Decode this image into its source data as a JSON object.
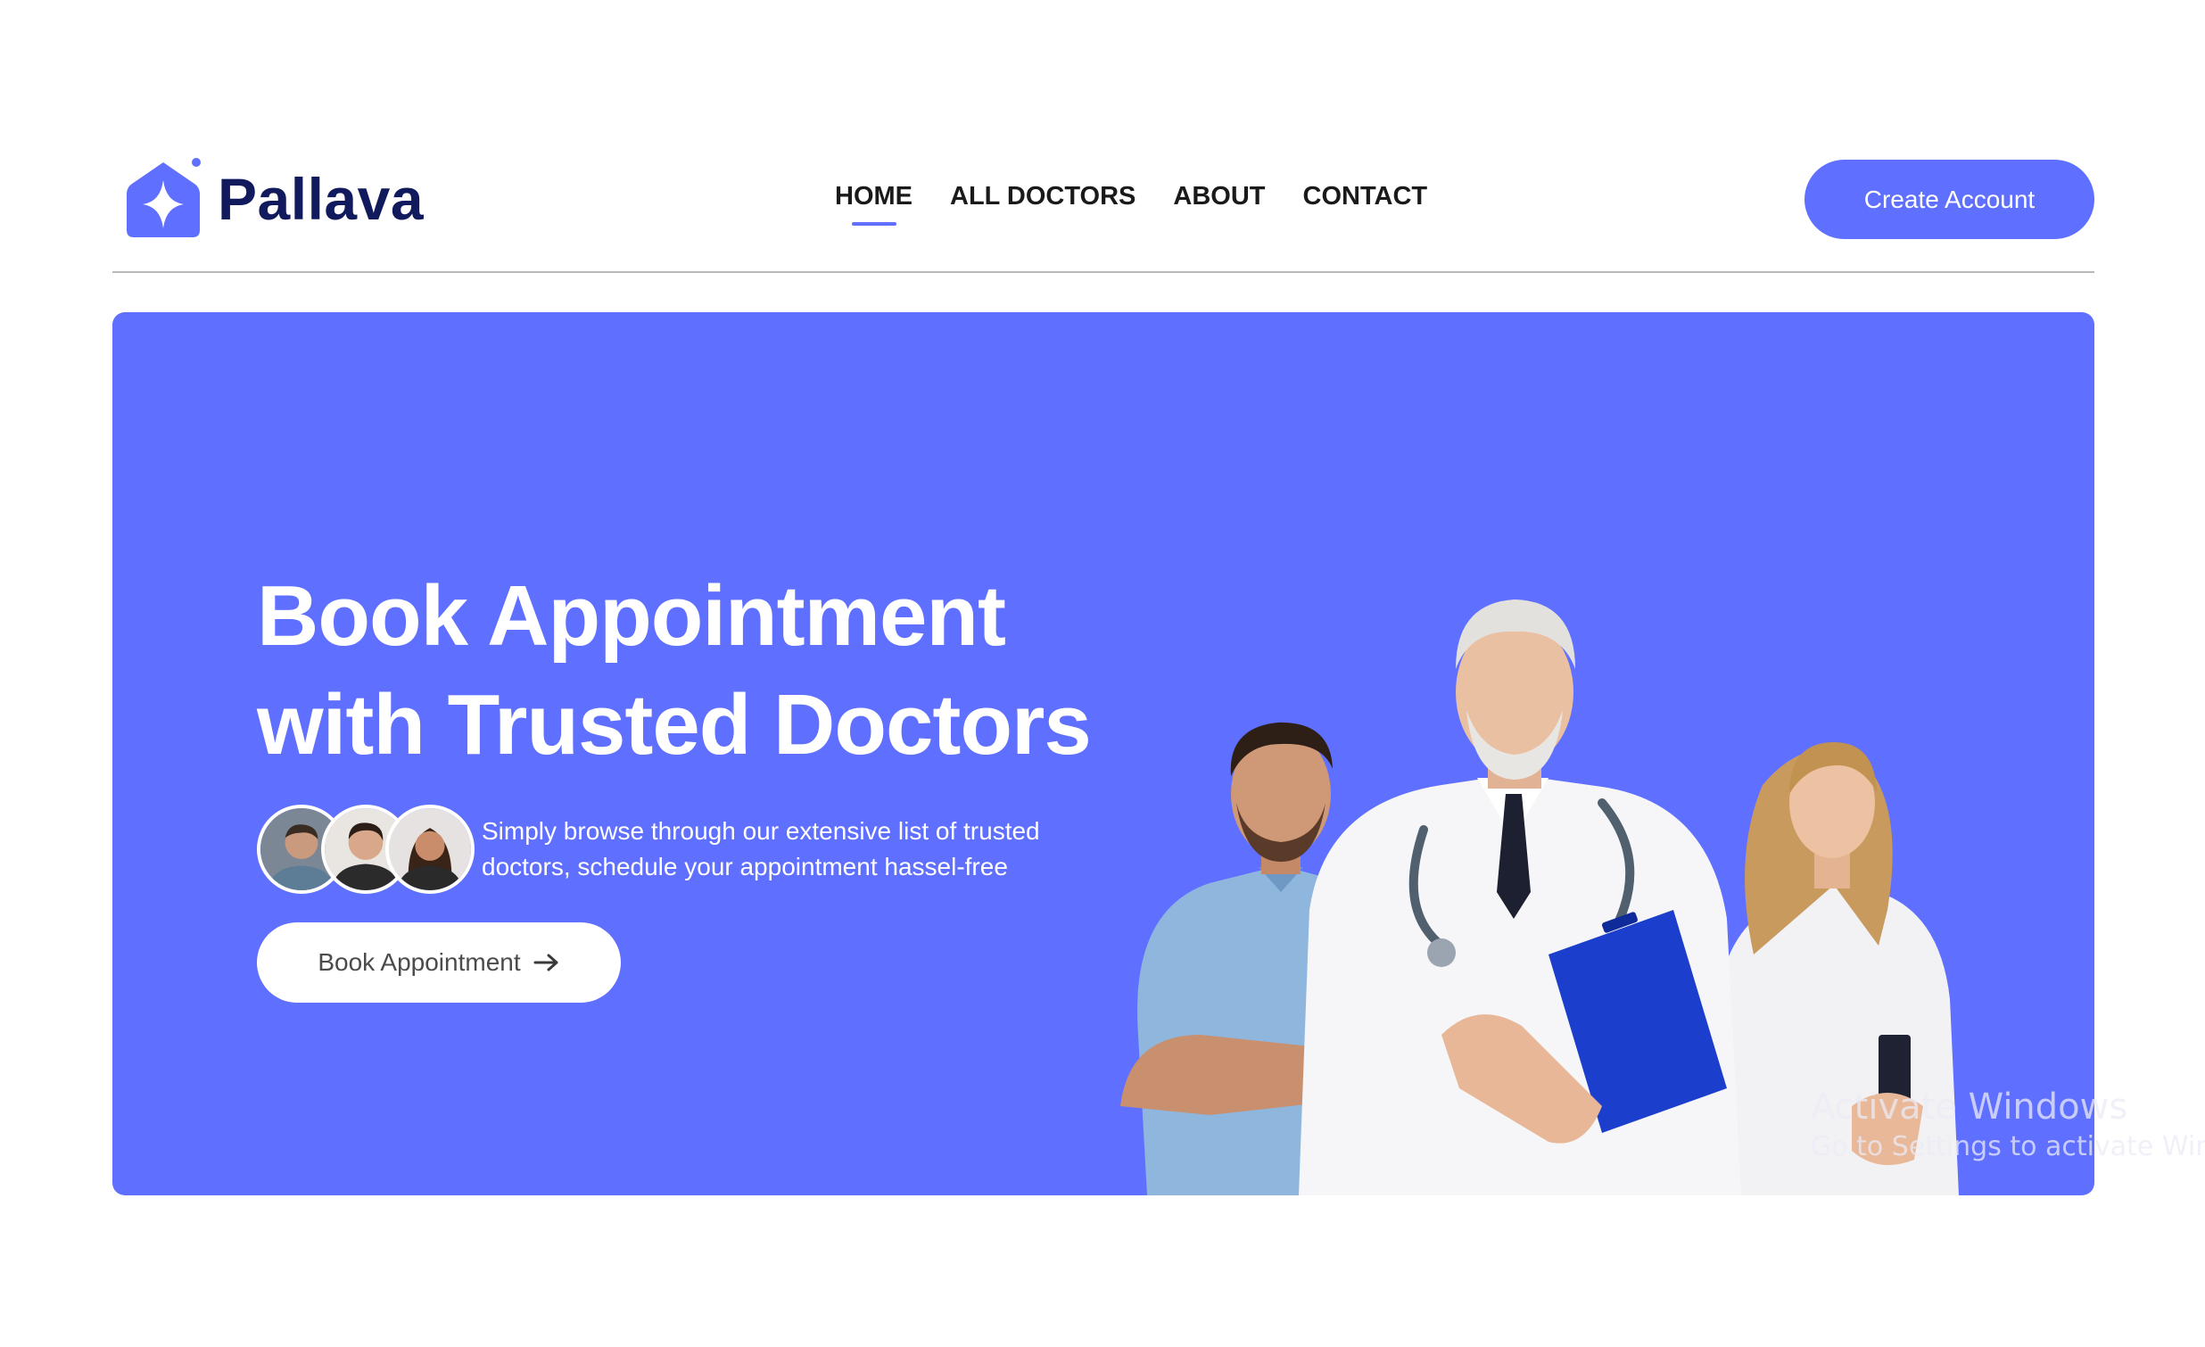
{
  "brand": {
    "name": "Pallava",
    "color": "#5f6fff",
    "text_color": "#101a5c"
  },
  "nav": {
    "items": [
      {
        "label": "HOME",
        "active": true
      },
      {
        "label": "ALL DOCTORS",
        "active": false
      },
      {
        "label": "ABOUT",
        "active": false
      },
      {
        "label": "CONTACT",
        "active": false
      }
    ]
  },
  "header": {
    "create_account_label": "Create Account"
  },
  "hero": {
    "title_line1": "Book Appointment",
    "title_line2": "with Trusted Doctors",
    "description_line1": "Simply browse through our extensive list of trusted",
    "description_line2": "doctors, schedule your appointment hassel-free",
    "book_button_label": "Book Appointment",
    "book_button_icon": "arrow-right-icon",
    "background_color": "#5f6fff"
  },
  "watermark": {
    "title": "Activate Windows",
    "subtitle": "Go to Settings to activate Windows."
  }
}
